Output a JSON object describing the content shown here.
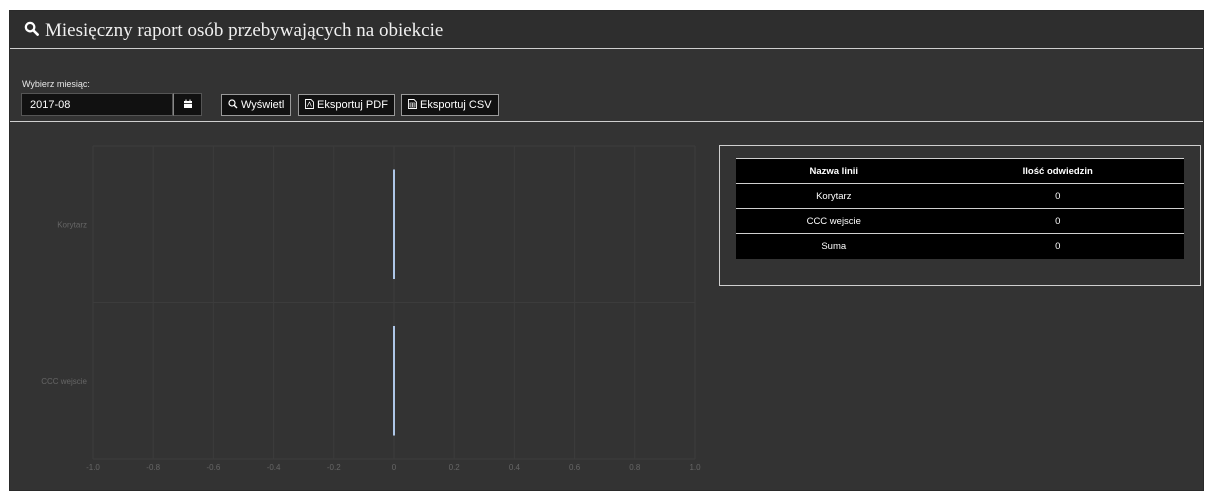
{
  "header": {
    "title": "Miesięczny raport osób przebywających na obiekcie",
    "icon": "search-icon"
  },
  "controls": {
    "month_label": "Wybierz miesiąc:",
    "month_value": "2017-08",
    "calendar_icon": "calendar-icon",
    "show_label": "Wyświetl",
    "pdf_label": "Eksportuj PDF",
    "csv_label": "Eksportuj CSV"
  },
  "chart_data": {
    "type": "bar",
    "orientation": "horizontal",
    "categories": [
      "Korytarz",
      "CCC wejscie"
    ],
    "values": [
      0,
      0
    ],
    "xlim": [
      -1.0,
      1.0
    ],
    "xticks": [
      "-1.0",
      "-0.8",
      "-0.6",
      "-0.4",
      "-0.2",
      "0",
      "0.2",
      "0.4",
      "0.6",
      "0.8",
      "1.0"
    ],
    "bar_color": "#aec7e8",
    "grid": true
  },
  "table": {
    "headers": [
      "Nazwa linii",
      "Ilość odwiedzin"
    ],
    "rows": [
      [
        "Korytarz",
        "0"
      ],
      [
        "CCC wejscie",
        "0"
      ],
      [
        "Suma",
        "0"
      ]
    ]
  },
  "colors": {
    "panel_bg": "#333333",
    "control_bg": "#111111",
    "accent_bar": "#aec7e8"
  }
}
